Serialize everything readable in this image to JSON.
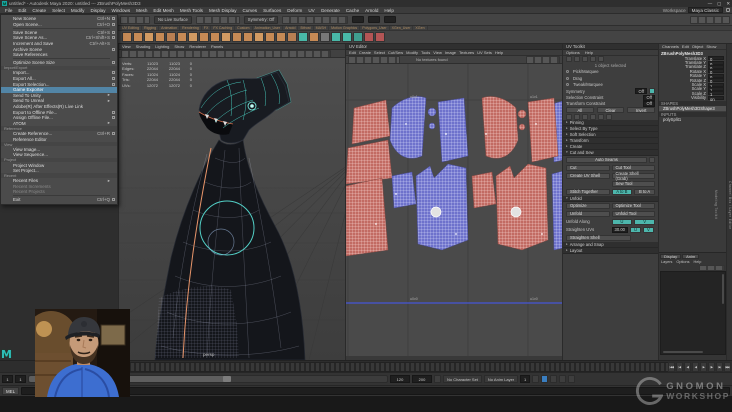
{
  "colors": {
    "accent": "#5285a6",
    "teal": "#4db6ac",
    "hl_blue": "#3a7ec0",
    "shell_blue": "#6e72cc",
    "shell_red": "#c26b63"
  },
  "titlebar": {
    "logo": "M",
    "title": "untitled* - Autodesk Maya 2020: untitled --- ZBrushPolyMesh3D3",
    "minimize": "—",
    "maximize": "▢",
    "close": "✕"
  },
  "menubar": {
    "items": [
      "File",
      "Edit",
      "Create",
      "Select",
      "Modify",
      "Display",
      "Windows",
      "Mesh",
      "Edit Mesh",
      "Mesh Tools",
      "Mesh Display",
      "Curves",
      "Surfaces",
      "Deform",
      "UV",
      "Generate",
      "Cache",
      "Arnold",
      "Help"
    ],
    "workspace_label": "Workspace",
    "workspace_value": "Maya Classic"
  },
  "statusline": {
    "live_surface": "No Live Surface",
    "symmetry": "Symmetry: Off"
  },
  "shelf": {
    "tabs": [
      "UV Editing",
      "Rigging",
      "Animation",
      "Rendering",
      "FX",
      "FX Caching",
      "Custom",
      "Animation_User",
      "Arnold",
      "Bifrost",
      "MASH",
      "Motion Graphics",
      "Polygons_User",
      "XGen_User",
      "XGen"
    ],
    "icons": [
      {
        "name": "poly-sphere-icon",
        "color": "#c68a55"
      },
      {
        "name": "poly-cube-icon",
        "color": "#c68a55"
      },
      {
        "name": "poly-cylinder-icon",
        "color": "#d19a62"
      },
      {
        "name": "poly-cone-icon",
        "color": "#c68a55"
      },
      {
        "name": "poly-torus-icon",
        "color": "#b97f52"
      },
      {
        "name": "poly-plane-icon",
        "color": "#c68a55"
      },
      {
        "name": "poly-disc-icon",
        "color": "#d19a62"
      },
      {
        "name": "poly-gear-icon",
        "color": "#c68a55"
      },
      {
        "name": "poly-soccer-icon",
        "color": "#c68a55"
      },
      {
        "name": "poly-superellipse-icon",
        "color": "#d19a62"
      },
      {
        "name": "poly-spiral-icon",
        "color": "#c68a55"
      },
      {
        "name": "poly-pipe-icon",
        "color": "#c68a55"
      },
      {
        "name": "poly-helix-icon",
        "color": "#d19a62"
      },
      {
        "name": "poly-pyramid-icon",
        "color": "#c68a55"
      },
      {
        "name": "poly-prism-icon",
        "color": "#c68a55"
      },
      {
        "name": "poly-platonic-icon",
        "color": "#b97f52"
      },
      {
        "name": "sculpt-tool-icon",
        "color": "#49b8a8"
      },
      {
        "name": "mirror-icon",
        "color": "#c68a55"
      },
      {
        "name": "combine-icon",
        "color": "#787878"
      },
      {
        "name": "separate-icon",
        "color": "#49b8a8"
      },
      {
        "name": "extrude-icon",
        "color": "#49b8a8"
      },
      {
        "name": "bevel-icon",
        "color": "#3f9e8f"
      },
      {
        "name": "multi-cut-icon",
        "color": "#b35555"
      },
      {
        "name": "quad-draw-icon",
        "color": "#b35555"
      }
    ]
  },
  "file_menu": {
    "items": [
      {
        "label": "New Scene",
        "shortcut": "Ctrl+N",
        "opt_class": "has-opt"
      },
      {
        "label": "Open Scene...",
        "shortcut": "Ctrl+O",
        "opt_class": "has-opt"
      },
      {
        "type": "sep"
      },
      {
        "label": "Save Scene",
        "shortcut": "Ctrl+S",
        "opt_class": "has-opt"
      },
      {
        "label": "Save Scene As...",
        "shortcut": "Ctrl+Shift+S",
        "opt_class": "has-opt"
      },
      {
        "label": "Increment and Save",
        "shortcut": "Ctrl+Alt+S"
      },
      {
        "label": "Archive Scene",
        "opt_class": "has-opt"
      },
      {
        "label": "Save References"
      },
      {
        "type": "sep"
      },
      {
        "label": "Optimize Scene Size",
        "opt_class": "has-opt"
      },
      {
        "type": "section",
        "label": "Import/Export"
      },
      {
        "label": "Import...",
        "opt_class": "has-opt"
      },
      {
        "label": "Export All...",
        "opt_class": "has-opt"
      },
      {
        "label": "Export Selection...",
        "opt_class": "has-opt"
      },
      {
        "label": "Game Exporter",
        "state": "highlight"
      },
      {
        "label": "Send To Unity",
        "shortcut": "▸"
      },
      {
        "label": "Send To Unreal",
        "shortcut": "▸"
      },
      {
        "label": "Adobe(R) After Effects(R) Live Link"
      },
      {
        "label": "Export to Offline File...",
        "opt_class": "has-opt"
      },
      {
        "label": "Assign Offline File...",
        "opt_class": "has-opt"
      },
      {
        "label": "ATOM",
        "shortcut": "▸"
      },
      {
        "type": "section",
        "label": "Reference"
      },
      {
        "label": "Create Reference...",
        "shortcut": "Ctrl+R",
        "opt_class": "has-opt"
      },
      {
        "label": "Reference Editor"
      },
      {
        "type": "section",
        "label": "View"
      },
      {
        "label": "View Image..."
      },
      {
        "label": "View Sequence..."
      },
      {
        "type": "section",
        "label": "Project"
      },
      {
        "label": "Project Window"
      },
      {
        "label": "Set Project..."
      },
      {
        "type": "section",
        "label": "Recent"
      },
      {
        "label": "Recent Files",
        "shortcut": "▸"
      },
      {
        "label": "Recent Increments",
        "state": "dim"
      },
      {
        "label": "Recent Projects",
        "state": "dim"
      },
      {
        "type": "sep"
      },
      {
        "label": "Exit",
        "shortcut": "Ctrl+Q",
        "opt_class": "has-opt"
      }
    ]
  },
  "viewport": {
    "menus": [
      "View",
      "Shading",
      "Lighting",
      "Show",
      "Renderer",
      "Panels"
    ],
    "hud_rows": [
      {
        "label": "Verts:",
        "a": "11023",
        "b": "11023",
        "c": "0"
      },
      {
        "label": "Edges:",
        "a": "22044",
        "b": "22044",
        "c": "0"
      },
      {
        "label": "Faces:",
        "a": "11024",
        "b": "11024",
        "c": "0"
      },
      {
        "label": "Tris:",
        "a": "22044",
        "b": "22044",
        "c": "0"
      },
      {
        "label": "UVs:",
        "a": "12072",
        "b": "12072",
        "c": "0"
      }
    ],
    "camera_label": "persp"
  },
  "uv_editor": {
    "title": "UV Editor",
    "menus": [
      "Edit",
      "Create",
      "Select",
      "Cut/Sew",
      "Modify",
      "Tools",
      "View",
      "Image",
      "Textures",
      "UV Sets",
      "Help"
    ],
    "texture_status": "No textures found",
    "tile_labels": {
      "tl": "u0v1",
      "tr": "u1v1",
      "bl": "u0v0",
      "br": "u1v0"
    }
  },
  "uv_toolkit": {
    "title": "UV Toolkit",
    "menu_items": [
      "Options",
      "Help"
    ],
    "object_status": "1 object selected",
    "modes": [
      "Pick/Marquee",
      "Drag",
      "Tweak/Marquee"
    ],
    "symmetry_label": "Symmetry",
    "symmetry_value": "Off",
    "selection_constraint_label": "Selection Constraint",
    "selection_constraint_value": "Off",
    "transform_constraint_label": "Transform Constraint",
    "transform_constraint_value": "Off",
    "select_buttons": [
      "All",
      "Clear",
      "Invert"
    ],
    "collapsed_sections": [
      "Pinning",
      "Select By Type",
      "Soft Selection",
      "Transform",
      "Create"
    ],
    "cut_sew_section": "Cut and Sew",
    "auto_seams": "Auto Seams",
    "cut_label": "Cut",
    "cut_tool": "Cut Tool",
    "create_uv_shell": "Create UV Shell",
    "create_shell_grab": "Create Shell (Grab)",
    "sew_tool": "Sew Tool",
    "stitch_together": "Stitch Together",
    "a_to_b": "A to B",
    "b_to_a": "B to A",
    "unfold_section": "Unfold",
    "optimize": "Optimize",
    "optimize_tool": "Optimize Tool",
    "unfold": "Unfold",
    "unfold_tool": "Unfold Tool",
    "unfold_along": "Unfold Along",
    "u": "U",
    "v": "V",
    "straighten_uvs": "Straighten UVs",
    "straighten_value": "30.00",
    "straighten_shell": "Straighten Shell",
    "bottom_sections": [
      "Arrange and Snap",
      "Layout"
    ]
  },
  "channel_box": {
    "menus": [
      "Channels",
      "Edit",
      "Object",
      "Show"
    ],
    "object_name": "ZBrushPolyMesh3D3",
    "attributes": [
      {
        "label": "Translate X",
        "value": "0"
      },
      {
        "label": "Translate Y",
        "value": "0"
      },
      {
        "label": "Translate Z",
        "value": "0"
      },
      {
        "label": "Rotate X",
        "value": "0"
      },
      {
        "label": "Rotate Y",
        "value": "0"
      },
      {
        "label": "Rotate Z",
        "value": "0"
      },
      {
        "label": "Scale X",
        "value": "1"
      },
      {
        "label": "Scale Y",
        "value": "1"
      },
      {
        "label": "Scale Z",
        "value": "1"
      },
      {
        "label": "Visibility",
        "value": "on"
      }
    ],
    "shapes_header": "SHAPES",
    "shape_name": "ZBrushPolyMesh3DShape3",
    "inputs_header": "INPUTS",
    "input_name": "polySplit1",
    "side_tabs": [
      "Channel Box / Layer Editor",
      "Modeling Toolkit"
    ]
  },
  "layer_editor": {
    "tabs": [
      "Display",
      "Anim"
    ],
    "menus": [
      "Layers",
      "Options",
      "Help"
    ]
  },
  "timeline": {
    "current_frame": "1",
    "range_start": "1",
    "range_start2": "1",
    "range_end": "120",
    "scene_end": "200",
    "character_set": "No Character Set",
    "anim_layer": "No Anim Layer",
    "frame_field": "1",
    "transport": [
      "|◀◀",
      "|◀",
      "◀|",
      "◀",
      "▶",
      "|▶",
      "▶|",
      "▶▶|"
    ]
  },
  "command_line": {
    "label": "MEL"
  },
  "watermark": {
    "line1": "GNOMON",
    "line2": "WORKSHOP"
  },
  "maya_badge": "M"
}
